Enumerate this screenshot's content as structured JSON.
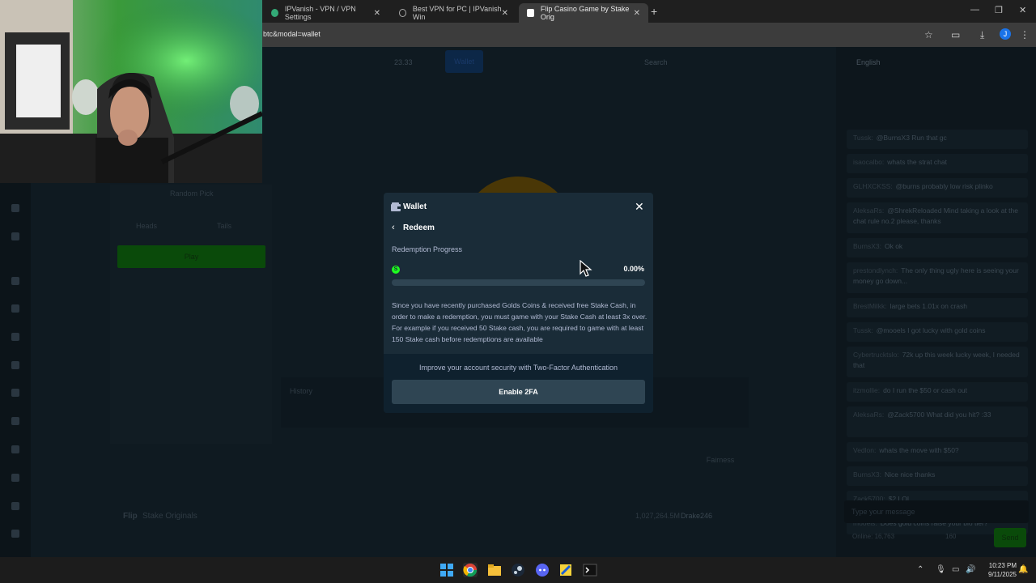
{
  "browser": {
    "tabs": [
      {
        "title": "IPVanish - VPN / VPN Settings",
        "active": false
      },
      {
        "title": "Best VPN for PC | IPVanish Win",
        "active": false
      },
      {
        "title": "Flip Casino Game by Stake Orig",
        "active": true
      }
    ],
    "url": "btc&modal=wallet",
    "profile_initial": "J"
  },
  "site": {
    "balance": "23.33",
    "wallet_label": "Wallet",
    "search_label": "Search",
    "random_pick": "Random Pick",
    "heads": "Heads",
    "tails": "Tails",
    "play": "Play",
    "history": "History",
    "fairness": "Fairness",
    "footer_game": "Flip",
    "footer_brand": "Stake Originals",
    "footer_amount": "1,027,264.5M",
    "footer_user": "Drake246"
  },
  "chat": {
    "language": "English",
    "messages": [
      {
        "user": "Tussk:",
        "text": "@BurnsX3 Run that gc"
      },
      {
        "user": "isaocalbo:",
        "text": "whats the strat chat"
      },
      {
        "user": "GLHXCKSS:",
        "text": "@burns probably low risk plinko"
      },
      {
        "user": "AleksaRs:",
        "text": "@ShrekReloaded Mind taking a look at the chat rule no.2 please, thanks"
      },
      {
        "user": "BurnsX3:",
        "text": "Ok ok"
      },
      {
        "user": "prestondlynch:",
        "text": "The only thing ugly here is seeing your money go down..."
      },
      {
        "user": "BrestMilkk:",
        "text": "large bets 1.01x on crash"
      },
      {
        "user": "Tussk:",
        "text": "@mooels I got lucky with gold coins"
      },
      {
        "user": "Cybertrucktslo:",
        "text": "72k up this week lucky week, I needed that"
      },
      {
        "user": "itzmollie:",
        "text": "do I run the $50 or cash out"
      },
      {
        "user": "AleksaRs:",
        "text": "@Zack5700 What did you hit? :33"
      },
      {
        "user": "Vedlon:",
        "text": "whats the move with $50?"
      },
      {
        "user": "BurnsX3:",
        "text": "Nice nice thanks"
      },
      {
        "user": "Zack5700:",
        "text": "$2 LOL"
      },
      {
        "user": "mooels:",
        "text": "Does gold coins raise your bio tier?"
      }
    ],
    "input_placeholder": "Type your message",
    "online": "Online: 16,763",
    "counter": "160",
    "send": "Send"
  },
  "modal": {
    "title": "Wallet",
    "subtitle": "Redeem",
    "progress_label": "Redemption Progress",
    "currency_symbol": "S",
    "progress_text": "0.00%",
    "progress_fraction": 0,
    "body": "Since you have recently purchased Golds Coins & received free Stake Cash, in order to make a redemption, you must game with your Stake Cash at least 3x over. For example if you received 50 Stake cash, you are required to game with at least 150 Stake cash before redemptions are available",
    "twofa_text": "Improve your account security with Two-Factor Authentication",
    "twofa_button": "Enable 2FA"
  },
  "taskbar": {
    "time": "10:23 PM",
    "date": "9/11/2025"
  },
  "colors": {
    "accent_green": "#1fff20",
    "modal_bg": "#1a2c38",
    "wallet_blue": "#1475e1"
  }
}
